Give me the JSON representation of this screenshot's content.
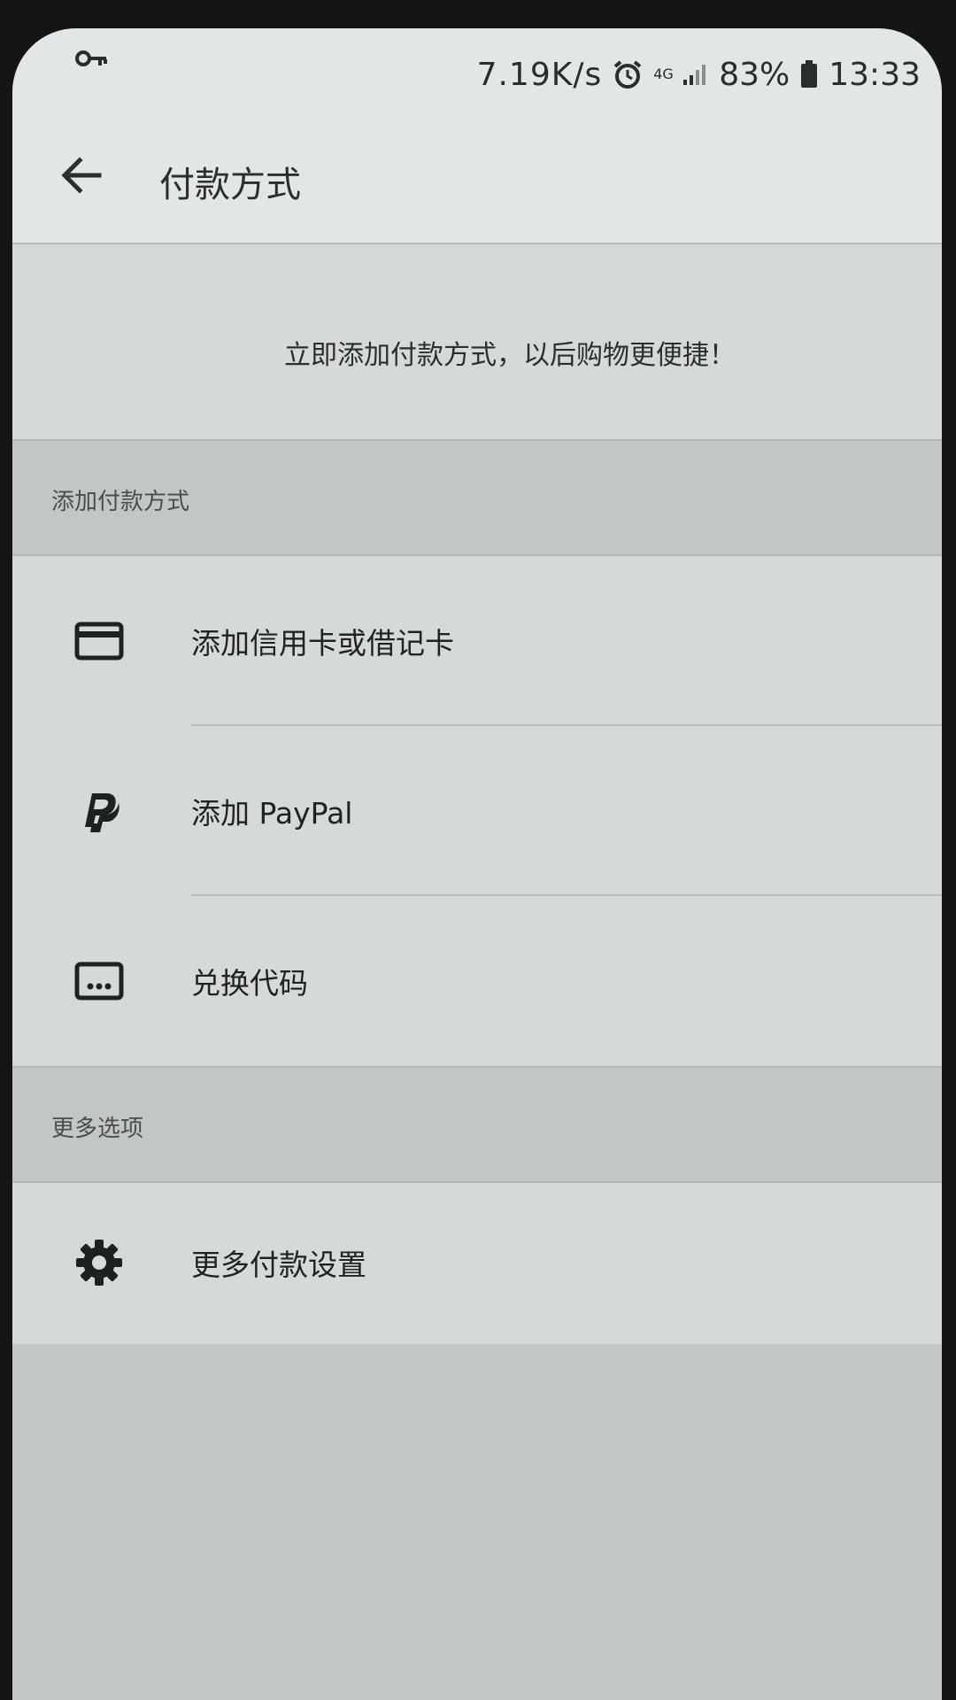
{
  "status_bar": {
    "net_speed": "7.19K/s",
    "network_type": "4G",
    "battery": "83%",
    "time": "13:33",
    "icons": [
      "key-icon",
      "alarm-icon",
      "signal-icon",
      "battery-icon"
    ]
  },
  "app_bar": {
    "title": "付款方式",
    "back_icon": "arrow-left-icon"
  },
  "banner": {
    "text": "立即添加付款方式，以后购物更便捷！"
  },
  "sections": [
    {
      "header": "添加付款方式",
      "items": [
        {
          "label": "添加信用卡或借记卡",
          "icon": "credit-card-icon"
        },
        {
          "label": "添加 PayPal",
          "icon": "paypal-icon"
        },
        {
          "label": "兑换代码",
          "icon": "redeem-code-icon"
        }
      ]
    },
    {
      "header": "更多选项",
      "items": [
        {
          "label": "更多付款设置",
          "icon": "gear-icon"
        }
      ]
    }
  ],
  "colors": {
    "surface": "#d6d9d9",
    "section_header": "#c3c6c6",
    "app_bar": "#e3e6e6",
    "text_primary": "#202324",
    "text_secondary": "#4a4d4e"
  }
}
